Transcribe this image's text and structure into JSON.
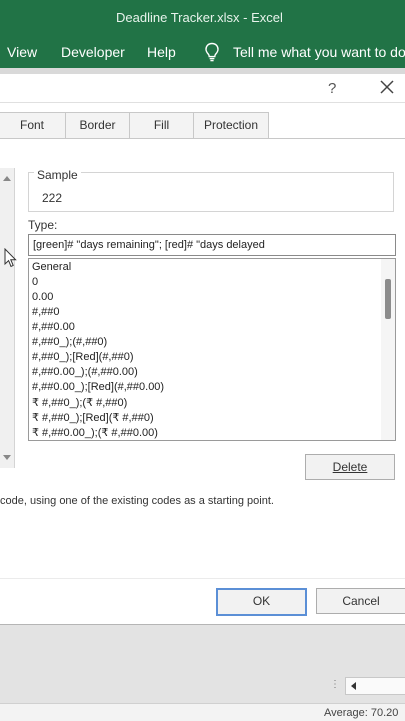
{
  "window": {
    "title": "Deadline Tracker.xlsx  -  Excel"
  },
  "ribbon": {
    "tabs": [
      "View",
      "Developer",
      "Help"
    ],
    "tell_me": "Tell me what you want to do"
  },
  "dialog": {
    "help_glyph": "?",
    "tabs": [
      "Font",
      "Border",
      "Fill",
      "Protection"
    ],
    "sample_label": "Sample",
    "sample_value": "222",
    "type_label": "Type:",
    "type_value": "[green]# \"days remaining\"; [red]# \"days delayed",
    "format_codes": [
      "General",
      "0",
      "0.00",
      "#,##0",
      "#,##0.00",
      "#,##0_);(#,##0)",
      "#,##0_);[Red](#,##0)",
      "#,##0.00_);(#,##0.00)",
      "#,##0.00_);[Red](#,##0.00)",
      "₹ #,##0_);(₹ #,##0)",
      "₹ #,##0_);[Red](₹ #,##0)",
      "₹ #,##0.00_);(₹ #,##0.00)"
    ],
    "delete_label": "Delete",
    "description": "code, using one of the existing codes as a starting point.",
    "ok_label": "OK",
    "cancel_label": "Cancel"
  },
  "status": {
    "average_text": "Average: 70.20"
  },
  "colors": {
    "excel_green": "#217346",
    "ok_border": "#5b8fd6"
  },
  "icons": [
    "lightbulb-icon",
    "close-icon",
    "help-icon",
    "mouse-cursor-icon"
  ]
}
